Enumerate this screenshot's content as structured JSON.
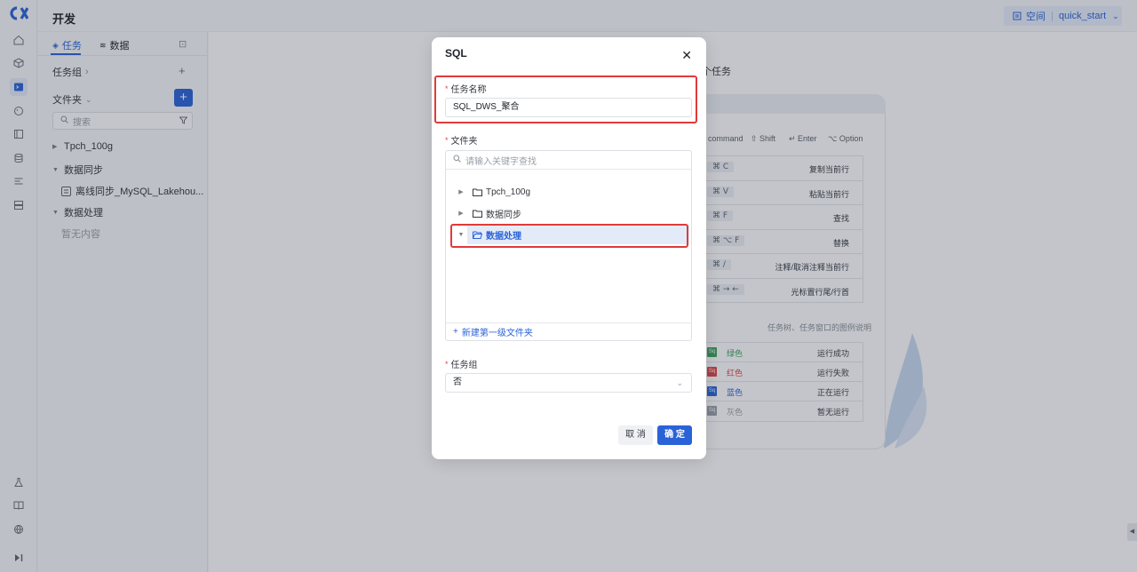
{
  "header": {
    "title": "开发",
    "workspace_label": "空间",
    "workspace_name": "quick_start"
  },
  "sidebar": {
    "tabs": [
      {
        "label": "任务"
      },
      {
        "label": "数据"
      }
    ],
    "task_group": "任务组",
    "folder": "文件夹",
    "search_placeholder": "搜索",
    "tree": [
      {
        "label": "Tpch_100g"
      },
      {
        "label": "数据同步"
      },
      {
        "label": "离线同步_MySQL_Lakehou..."
      },
      {
        "label": "数据处理"
      },
      {
        "label": "暂无内容"
      }
    ]
  },
  "background": {
    "title_partial": "个任务",
    "keys": {
      "command": "command",
      "shift": "Shift",
      "enter": "Enter",
      "option": "Option"
    },
    "shortcuts": [
      {
        "key": "⌘ C",
        "desc": "复制当前行"
      },
      {
        "key": "⌘ V",
        "desc": "粘贴当前行"
      },
      {
        "key": "⌘ F",
        "desc": "查找"
      },
      {
        "key": "⌘ ⌥ F",
        "desc": "替换"
      },
      {
        "key": "⌘ /",
        "desc": "注释/取消注释当前行"
      },
      {
        "key": "⌘ → ←",
        "desc": "光标置行尾/行首"
      }
    ],
    "legend_caption": "任务树、任务窗口的图例说明",
    "legend": [
      {
        "color_name": "绿色",
        "status": "运行成功",
        "hex": "#3aa35a"
      },
      {
        "color_name": "红色",
        "status": "运行失败",
        "hex": "#e04545"
      },
      {
        "color_name": "蓝色",
        "status": "正在运行",
        "hex": "#2a63d8"
      },
      {
        "color_name": "灰色",
        "status": "暂无运行",
        "hex": "#9aa0a8"
      }
    ],
    "legend_icon_text": "Sq"
  },
  "modal": {
    "title": "SQL",
    "task_name_label": "任务名称",
    "task_name_value": "SQL_DWS_聚合",
    "folder_label": "文件夹",
    "folder_search_placeholder": "请输入关键字查找",
    "folders": [
      {
        "label": "Tpch_100g"
      },
      {
        "label": "数据同步"
      },
      {
        "label": "数据处理"
      }
    ],
    "new_folder": "新建第一级文件夹",
    "task_group_label": "任务组",
    "task_group_value": "否",
    "cancel": "取 消",
    "ok": "确 定"
  },
  "colors": {
    "accent": "#2a63d8",
    "highlight": "#e23a3a"
  }
}
